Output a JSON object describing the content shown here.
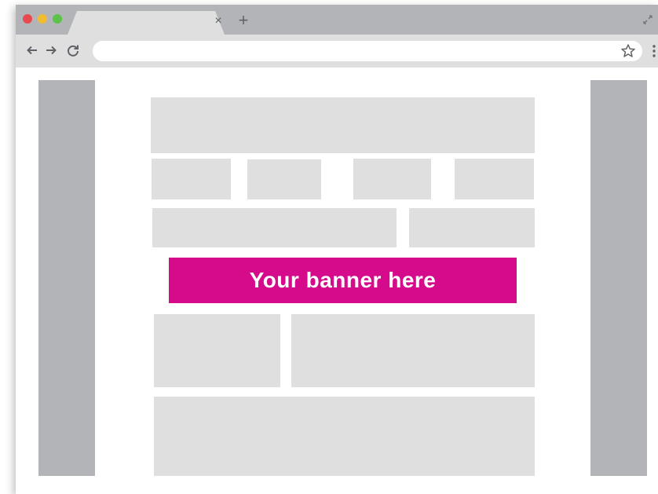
{
  "browser": {
    "tab_close": "×",
    "new_tab": "+",
    "traffic_lights": [
      "#e8494f",
      "#f2bc32",
      "#5bc448"
    ],
    "icons": [
      "back-arrow-icon",
      "forward-arrow-icon",
      "reload-icon",
      "star-icon",
      "menu-icon",
      "restore-icon"
    ]
  },
  "banner": {
    "text": "Your banner here",
    "color": "#d60b8c"
  },
  "colors": {
    "sidebar": "#b3b4b8",
    "placeholder": "#dfdfe0",
    "page": "#ffffff"
  }
}
